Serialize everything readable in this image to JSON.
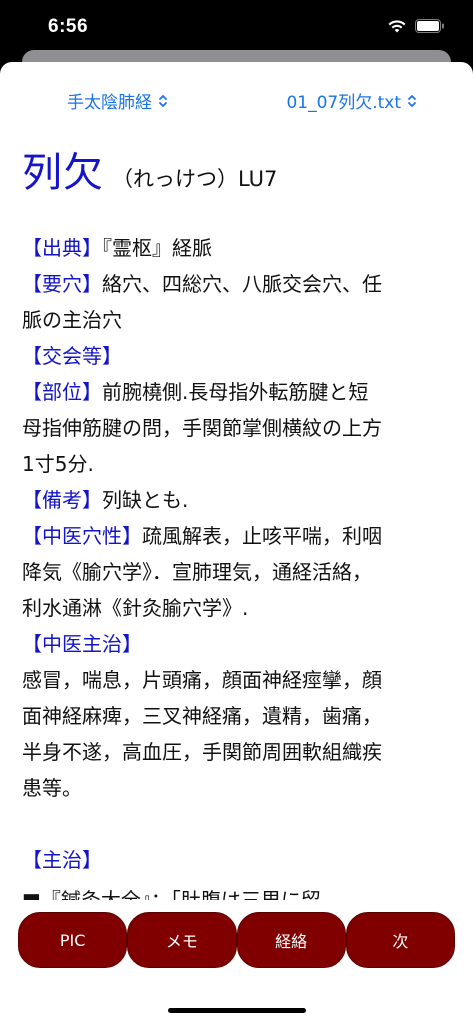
{
  "status": {
    "time": "6:56"
  },
  "header": {
    "left_picker": "手太陰肺経",
    "right_picker": "01_07列欠.txt"
  },
  "title": {
    "main": "列欠",
    "sub": "（れっけつ）LU7"
  },
  "sections": {
    "s1_tag": "【出典】",
    "s1_text": "『霊枢』経脈",
    "s2_tag": "【要穴】",
    "s2_text1": "絡穴、四総穴、八脈交会穴、任",
    "s2_text2": "脈の主治穴",
    "s3_tag": "【交会等】",
    "s4_tag": "【部位】",
    "s4_text1": "前腕橈側.長母指外転筋腱と短",
    "s4_text2": "母指伸筋腱の問，手関節掌側横紋の上方",
    "s4_text3": "1寸5分.",
    "s5_tag": "【備考】",
    "s5_text": "列缺とも.",
    "s6_tag": "【中医穴性】",
    "s6_text1": "疏風解表，止咳平喘，利咽",
    "s6_text2": "降気《腧穴学》．宣肺理気，通経活絡，",
    "s6_text3": "利水通淋《針灸腧穴学》.",
    "s7_tag": "【中医主治】",
    "s7_text1": "感冒，喘息，片頭痛，顔面神経痙攣，顔",
    "s7_text2": "面神経麻痺，三叉神経痛，遺精，歯痛，",
    "s7_text3": "半身不遂，高血圧，手関節周囲軟組織疾",
    "s7_text4": "患等。",
    "s8_tag": "【主治】",
    "s8_cut": "■『鍼灸大全』：「肚腹は三里に留"
  },
  "buttons": {
    "pic": "PIC",
    "memo": "メモ",
    "meridian": "経絡",
    "next": "次"
  }
}
